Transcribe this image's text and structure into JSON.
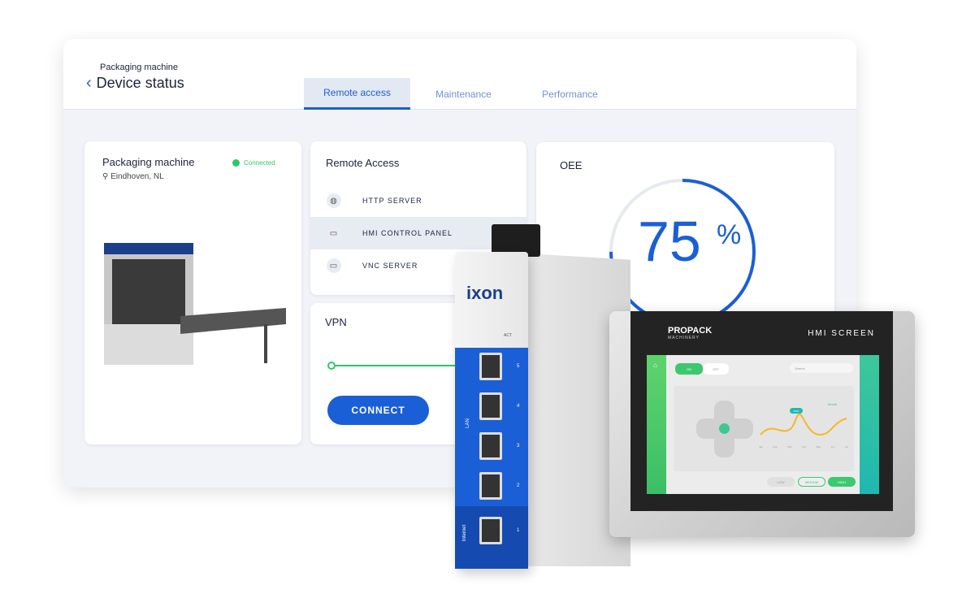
{
  "header": {
    "breadcrumb": "Packaging machine",
    "title": "Device status"
  },
  "tabs": [
    {
      "label": "Remote access",
      "active": true
    },
    {
      "label": "Maintenance"
    },
    {
      "label": "Performance"
    }
  ],
  "machine": {
    "name": "Packaging machine",
    "status": "Connected",
    "location": "Eindhoven, NL",
    "status_color": "#2ec866"
  },
  "remote_access": {
    "title": "Remote Access",
    "items": [
      {
        "label": "HTTP SERVER",
        "icon": "globe-icon"
      },
      {
        "label": "HMI CONTROL PANEL",
        "icon": "cast-icon",
        "selected": true
      },
      {
        "label": "VNC SERVER",
        "icon": "cast-icon"
      }
    ]
  },
  "vpn": {
    "title": "VPN",
    "button": "CONNECT"
  },
  "oee": {
    "title": "OEE",
    "value": "75",
    "unit": "%",
    "percent": 75
  },
  "device": {
    "brand": "ixon",
    "leds": [
      "ACT"
    ],
    "port_labels": [
      "5",
      "4",
      "3",
      "2",
      "1"
    ],
    "lan": "LAN",
    "internet": "Internet"
  },
  "hmi": {
    "brand": "PROPACK",
    "brand_sub": "MACHINERY",
    "title": "HMI SCREEN",
    "on": "ON",
    "off": "OFF",
    "search": "Search",
    "dropdown": "Month",
    "tooltip": "0518",
    "months": [
      "Jan",
      "Feb",
      "Mar",
      "Apr",
      "May",
      "Jun",
      "Jul"
    ],
    "buttons": [
      "LOW",
      "MEDIUM",
      "HIGH"
    ]
  },
  "colors": {
    "accent": "#1a5fd6",
    "green": "#2ec866"
  }
}
